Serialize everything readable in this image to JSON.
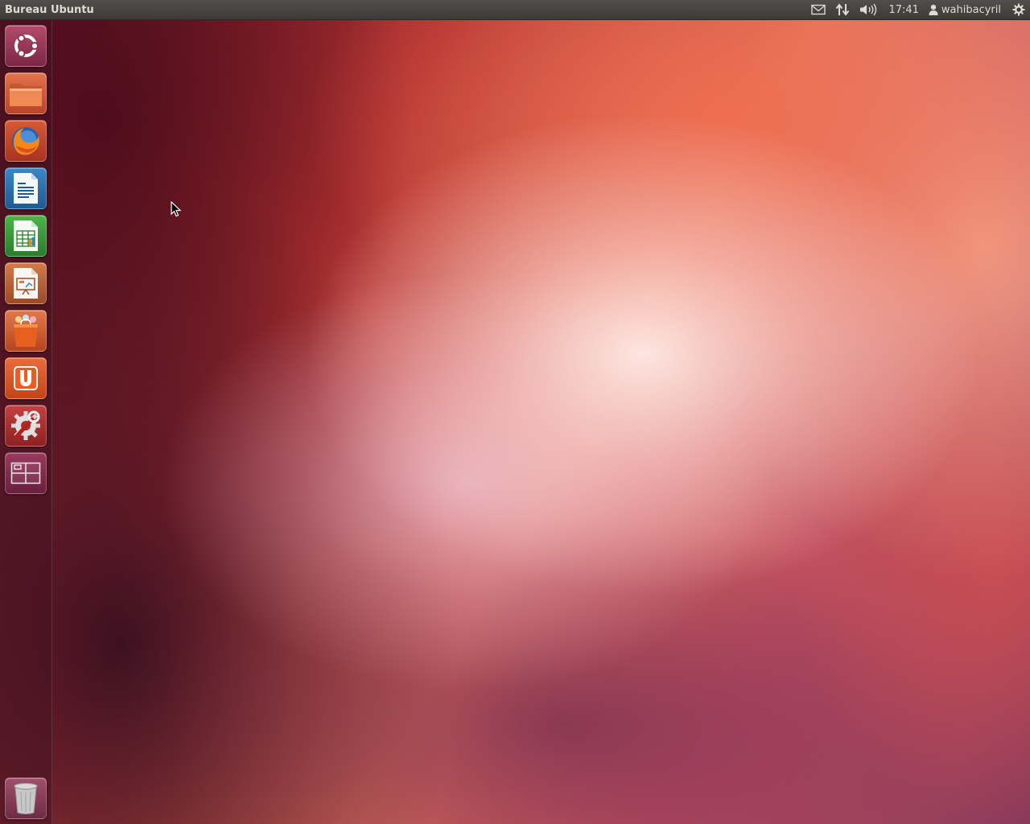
{
  "panel": {
    "title": "Bureau Ubuntu",
    "clock": "17:41",
    "user": "wahibacyril",
    "indicators": {
      "messaging": "envelope-icon",
      "network": "network-arrows-icon",
      "sound": "speaker-icon",
      "user": "person-icon",
      "session": "gear-icon"
    }
  },
  "launcher": {
    "items": [
      {
        "name": "dash-home",
        "icon": "ubuntu-logo-icon"
      },
      {
        "name": "files",
        "icon": "folder-icon"
      },
      {
        "name": "firefox",
        "icon": "firefox-icon"
      },
      {
        "name": "libreoffice-writer",
        "icon": "writer-icon"
      },
      {
        "name": "libreoffice-calc",
        "icon": "calc-icon"
      },
      {
        "name": "libreoffice-impress",
        "icon": "impress-icon"
      },
      {
        "name": "software-center",
        "icon": "shopping-bag-icon"
      },
      {
        "name": "ubuntu-one",
        "icon": "ubuntu-one-icon"
      },
      {
        "name": "system-settings",
        "icon": "settings-wrench-icon"
      },
      {
        "name": "workspace-switcher",
        "icon": "workspaces-icon"
      },
      {
        "name": "trash",
        "icon": "trash-icon"
      }
    ]
  },
  "colors": {
    "panel_bg": "#3c3b37",
    "panel_text": "#dfdbd2",
    "accent_orange": "#dd4814",
    "wallpaper_dark": "#5a1224"
  }
}
